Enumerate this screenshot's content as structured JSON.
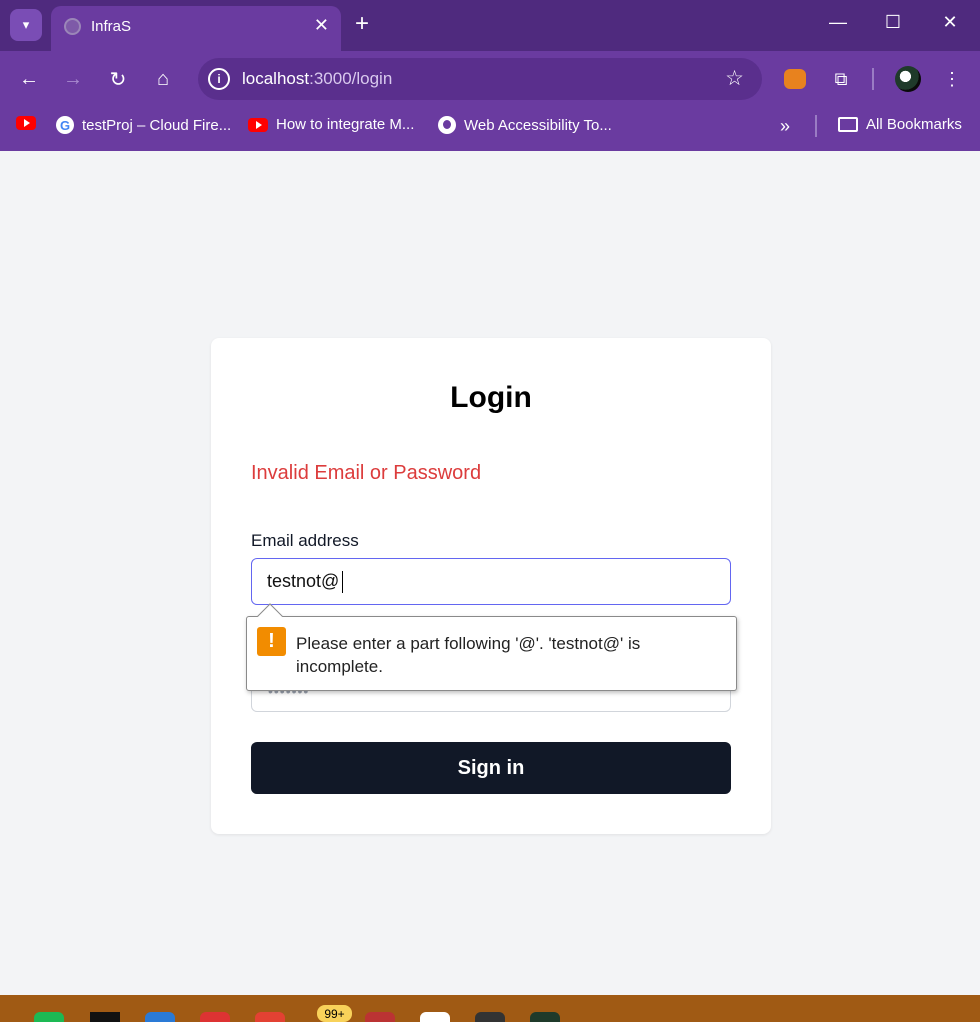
{
  "browser": {
    "tab_title": "InfraS",
    "url_host": "localhost",
    "url_path": ":3000/login",
    "bookmarks": [
      {
        "label": "testProj – Cloud Fire...",
        "icon": "google-icon"
      },
      {
        "label": "How to integrate M...",
        "icon": "youtube-icon"
      },
      {
        "label": "Web Accessibility To...",
        "icon": "globe-icon"
      }
    ],
    "all_bookmarks": "All Bookmarks"
  },
  "login": {
    "title": "Login",
    "error": "Invalid Email or Password",
    "email_label": "Email address",
    "email_value": "testnot@",
    "password_mask": "•••••••",
    "signin_label": "Sign in"
  },
  "validation": {
    "message": "Please enter a part following '@'. 'testnot@' is incomplete."
  },
  "taskbar": {
    "badge": "99+"
  },
  "colors": {
    "chrome": "#6a3ba0",
    "tabstrip": "#4f2a7e",
    "error": "#dc3c3c",
    "button": "#111827",
    "focus_border": "#6366f1",
    "warning": "#f28c00"
  }
}
